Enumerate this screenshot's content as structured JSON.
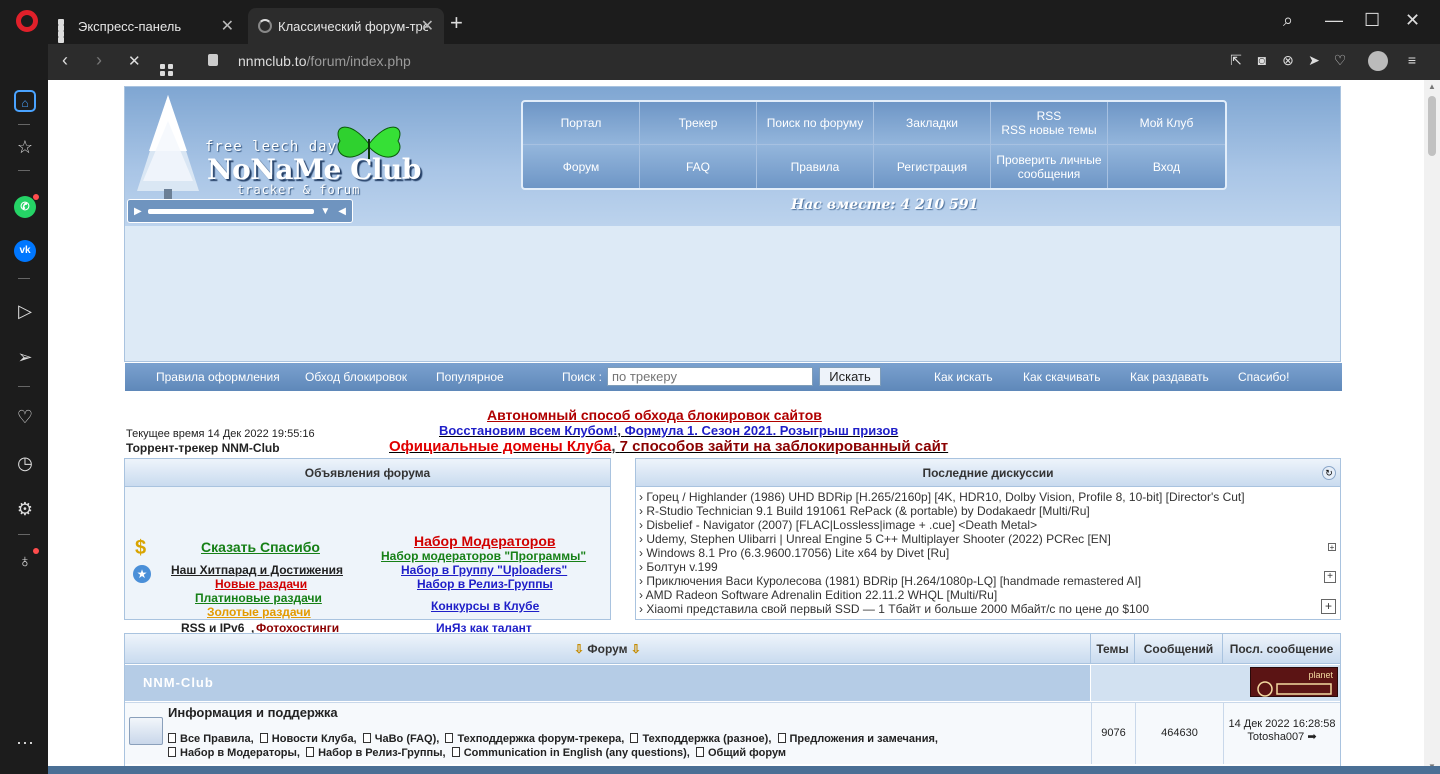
{
  "browser": {
    "tabs": [
      {
        "title": "Экспресс-панель"
      },
      {
        "title": "Классический форум-трек"
      }
    ],
    "url_host": "nnmclub.to",
    "url_path": "/forum/index.php"
  },
  "header": {
    "logo_line1": "free leech day",
    "logo_main": "NoNaMe Club",
    "logo_sub": "tracker & forum",
    "nav": [
      "Портал",
      "Трекер",
      "Поиск по форуму",
      "Закладки",
      "RSS\nRSS новые темы",
      "Мой Клуб",
      "Форум",
      "FAQ",
      "Правила",
      "Регистрация",
      "Проверить личные сообщения",
      "Вход"
    ],
    "together": "Нас вместе: 4 210 591"
  },
  "bar": {
    "links_left": [
      "Правила оформления",
      "Обход блокировок",
      "Популярное"
    ],
    "search_label": "Поиск :",
    "search_placeholder": "по трекеру",
    "search_button": "Искать",
    "links_right": [
      "Как искать",
      "Как скачивать",
      "Как раздавать",
      "Спасибо!"
    ]
  },
  "notices": {
    "time": "Текущее время 14 Дек 2022 19:55:16",
    "tracker": "Торрент-трекер NNM-Club",
    "n1": "Автономный способ обхода блокировок сайтов",
    "n2a": "Восстановим всем Клубом!",
    "n2b": "Формула 1. Сезон 2021. Розыгрыш призов",
    "n3a": "Официальные домены Клуба",
    "n3b": "7 способов зайти на заблокированный сайт"
  },
  "announcements": {
    "title": "Объявления форума",
    "say_thanks": "Сказать Спасибо",
    "hitparade": "Наш Хитпарад и Достижения",
    "new_releases": "Новые раздачи",
    "platinum": "Платиновые раздачи",
    "gold": "Золотые раздачи",
    "rss": "RSS и IPv6",
    "photo": "Фотохостинги",
    "mod_recruit": "Набор Модераторов",
    "mod_programs": "Набор модераторов \"Программы\"",
    "uploaders": "Набор в Группу \"Uploaders\"",
    "release_groups": "Набор в Релиз-Группы",
    "contests": "Конкурсы в Клубе",
    "inyaz": "ИнЯз как талант"
  },
  "discussions": {
    "title": "Последние дискуссии",
    "items": [
      "Горец / Highlander (1986) UHD BDRip [H.265/2160p] [4K, HDR10, Dolby Vision, Profile 8, 10-bit] [Director's Cut]",
      "R-Studio Technician 9.1 Build 191061 RePack (& portable) by Dodakaedr [Multi/Ru]",
      "Disbelief - Navigator (2007) [FLAC|Lossless|image + .cue] <Death Metal>",
      "Udemy, Stephen Ulibarri | Unreal Engine 5 C++ Multiplayer Shooter (2022) PCRec [EN]",
      "Windows 8.1 Pro (6.3.9600.17056) Lite x64 by Divet [Ru]",
      "Болтун v.199",
      "Приключения Васи Куролесова (1981) BDRip [H.264/1080p-LQ] [handmade remastered AI]",
      "AMD Radeon Software Adrenalin Edition 22.11.2 WHQL [Multi/Ru]",
      "Xiaomi представила свой первый SSD — 1 Тбайт и больше 2000 Мбайт/с по цене до $100"
    ]
  },
  "forum": {
    "col_forum": "Форум",
    "col_topics": "Темы",
    "col_posts": "Сообщений",
    "col_last": "Посл. сообщение",
    "category": "NNM-Club",
    "planet_label": "planet",
    "row": {
      "title": "Информация и поддержка",
      "subs_line1": [
        "Все Правила,",
        "Новости Клуба,",
        "ЧаВо (FAQ),",
        "Техподдержка форум-трекера,",
        "Техподдержка (разное),",
        "Предложения и замечания,"
      ],
      "subs_line2": [
        "Набор в Модераторы,",
        "Набор в Релиз-Группы,",
        "Communication in English (any questions),",
        "Общий форум"
      ],
      "topics": "9076",
      "posts": "464630",
      "last_date": "14 Дек 2022 16:28:58",
      "last_user": "Totosha007"
    }
  }
}
